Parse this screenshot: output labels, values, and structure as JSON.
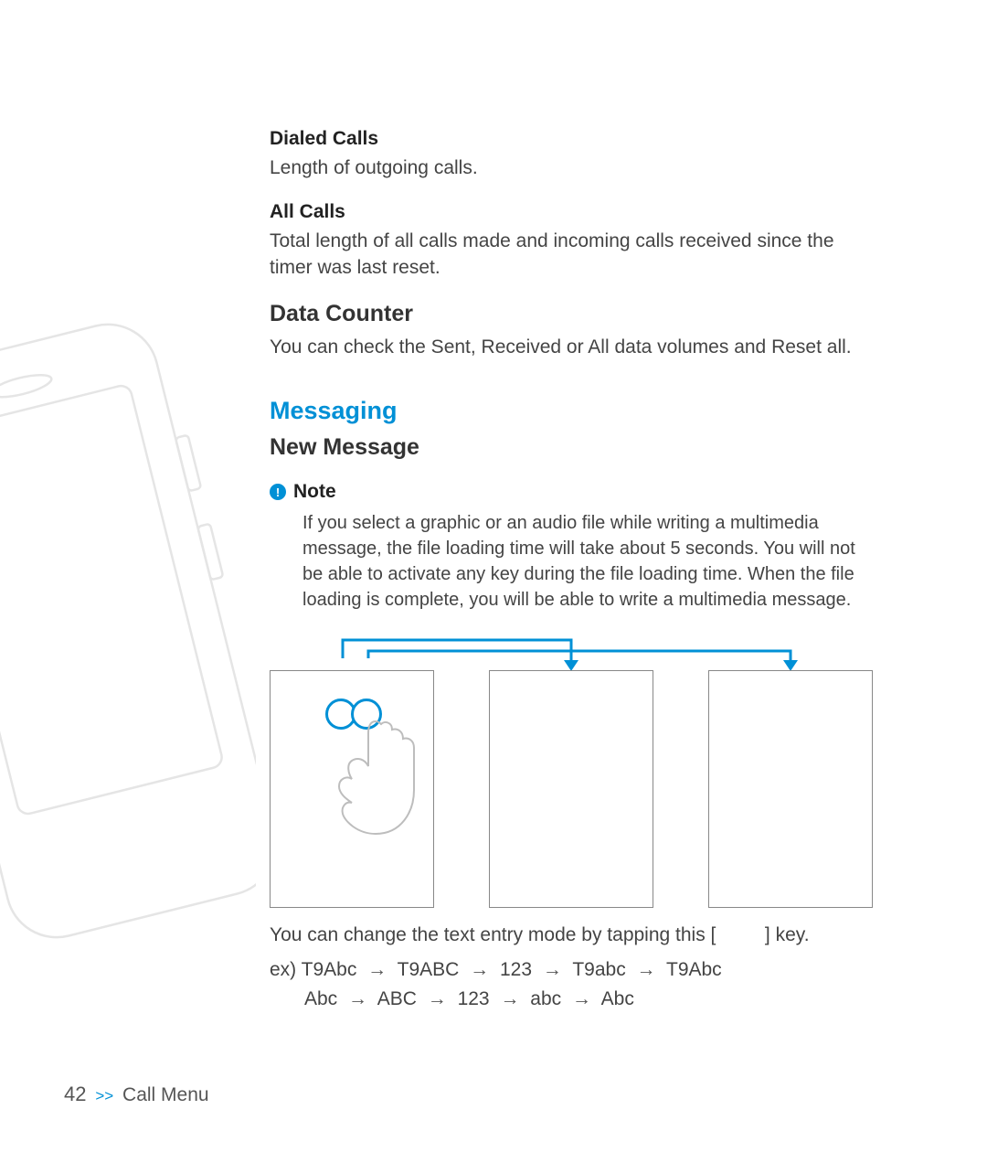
{
  "sections": {
    "dialed": {
      "heading": "Dialed Calls",
      "body": "Length of outgoing calls."
    },
    "all": {
      "heading": "All Calls",
      "body": "Total length of all calls made and incoming calls received since the timer was last reset."
    },
    "data": {
      "heading": "Data Counter",
      "body": "You can check the Sent, Received or All data volumes and Reset all."
    }
  },
  "messaging": {
    "heading": "Messaging",
    "sub": "New Message",
    "note_label": "Note",
    "note_body": "If you select a graphic or an audio file while writing a multimedia message, the file loading time will take about 5 seconds. You will not be able to activate any key during the file loading time. When the file loading is complete, you will be able to write a multimedia message."
  },
  "tap": {
    "pre": "You can change the text entry mode by tapping this [",
    "post": "] key."
  },
  "example": {
    "prefix": "ex) ",
    "seq1": [
      "T9Abc",
      "T9ABC",
      "123",
      "T9abc",
      "T9Abc"
    ],
    "seq2": [
      "Abc",
      "ABC",
      "123",
      "abc",
      "Abc"
    ]
  },
  "footer": {
    "page": "42",
    "breadcrumb": "Call Menu"
  }
}
